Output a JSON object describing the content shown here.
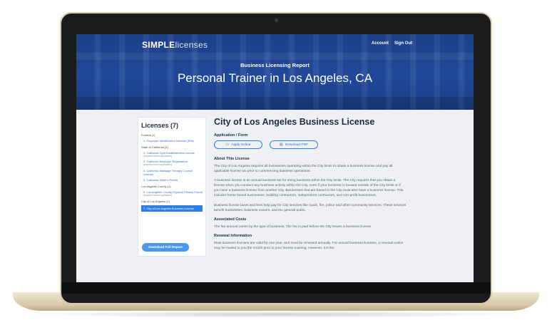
{
  "brand": {
    "strong": "SIMPLE",
    "light": "licenses"
  },
  "nav": {
    "account": "Account",
    "signout": "Sign Out"
  },
  "hero": {
    "subtitle": "Business Licensing Report",
    "title": "Personal Trainer in Los Angeles, CA"
  },
  "sidebar": {
    "title": "Licenses (7)",
    "groups": [
      {
        "label": "Federal (1)",
        "items": [
          {
            "text": "1. Employer Identification Number (EIN)"
          }
        ]
      },
      {
        "label": "State of California (4)",
        "items": [
          {
            "text": "2. California Gym Establishment License",
            "note": "(required when applicable)"
          },
          {
            "text": "3. California Employer Registration",
            "note": "(required when applicable)"
          },
          {
            "text": "4. California Massage Therapy Council License"
          },
          {
            "text": "5. California Seller's Permit"
          }
        ]
      },
      {
        "label": "Los Angeles County (1)",
        "items": [
          {
            "text": "6. Los Angeles County Physical Fitness Permit",
            "note": "(required when applicable)"
          }
        ]
      },
      {
        "label": "City of Los Angeles (1)",
        "items": [
          {
            "text": "7. City of Los Angeles Business License",
            "active": true
          }
        ]
      }
    ],
    "download_button": "Download Full Report"
  },
  "content": {
    "title": "City of Los Angeles Business License",
    "application_heading": "Application / Form",
    "apply_online": "Apply Online",
    "download_pdf": "Download PDF",
    "about_heading": "About This License",
    "about_paragraphs": [
      "The City of Los Angeles requires all businesses operating within the City limits to obtain a business license and pay all applicable license tax prior to commencing business operations.",
      "A business license is an annual business tax for doing business within the City limits. The City requires that you obtain a license when you conduct any business activity within the City, even if your business is located outside of the City limits or if you have a business license from another City. Businesses that are based in the City must also have a business license. This includes home based businesses, building contractors, independent contractors, and non-profit businesses.",
      "Business license taxes and fees help pay for City services like roads, fire, police and other community services. These services benefit businesses, business owners, and the general public."
    ],
    "costs_heading": "Associated Costs",
    "costs_text": "The fee amount varies by the type of business. The fee is paid before the City issues a business license.",
    "renewal_heading": "Renewal Information",
    "renewal_text": "Most business licenses are valid for one year, and must be renewed annually. For annual business licenses, a renewal notice may be mailed to you the month prior to your license expiring. However, it is the"
  },
  "colors": {
    "brand_blue": "#21489a",
    "accent": "#2e7ee6",
    "heading": "#1e2b44"
  }
}
